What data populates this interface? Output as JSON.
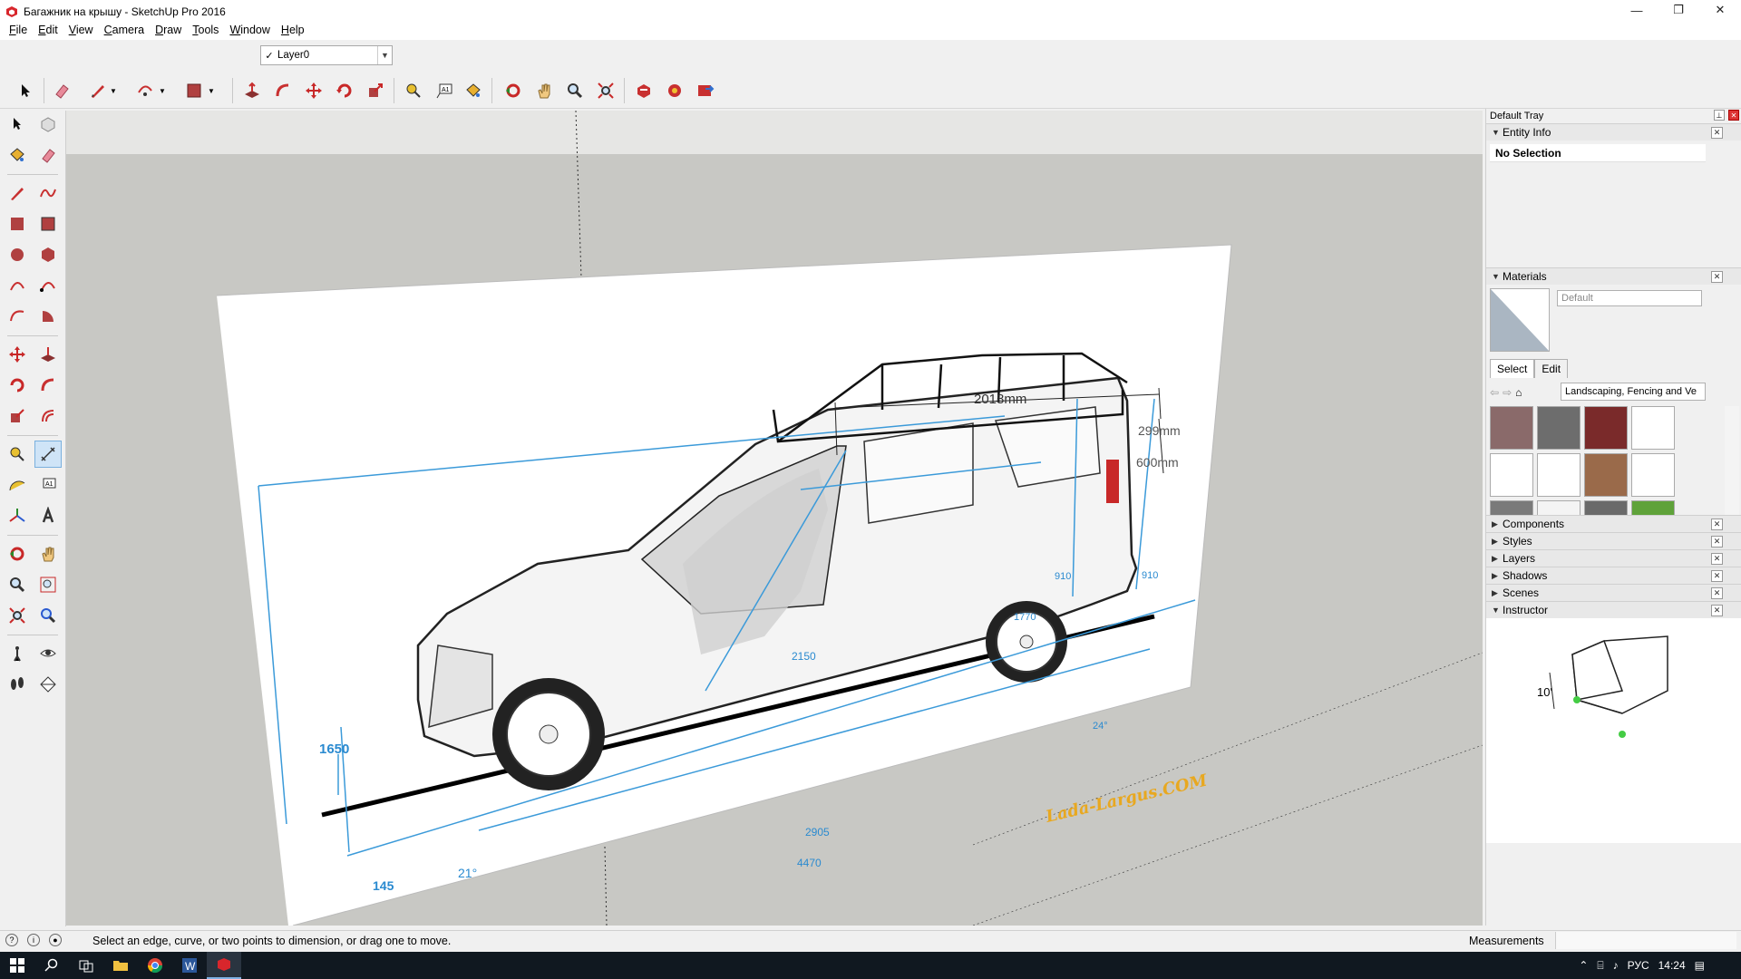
{
  "app": {
    "title": "Багажник на крышу - SketchUp Pro 2016",
    "window_controls": {
      "minimize": "—",
      "restore": "❐",
      "close": "✕"
    }
  },
  "menu": [
    {
      "label": "File",
      "ul": "F",
      "rest": "ile"
    },
    {
      "label": "Edit",
      "ul": "E",
      "rest": "dit"
    },
    {
      "label": "View",
      "ul": "V",
      "rest": "iew"
    },
    {
      "label": "Camera",
      "ul": "C",
      "rest": "amera"
    },
    {
      "label": "Draw",
      "ul": "D",
      "rest": "raw"
    },
    {
      "label": "Tools",
      "ul": "T",
      "rest": "ools"
    },
    {
      "label": "Window",
      "ul": "W",
      "rest": "indow"
    },
    {
      "label": "Help",
      "ul": "H",
      "rest": "elp"
    }
  ],
  "layer_toolbar": {
    "current_layer": "Layer0",
    "check": "✓"
  },
  "viewport": {
    "drawing": {
      "dim_roof_width": "2018mm",
      "dim_roof_height": "299mm",
      "dim_roof_600": "600mm",
      "dim_height": "1650",
      "dim_910_a": "910",
      "dim_910_b": "910",
      "dim_1770": "1770",
      "dim_2150": "2150",
      "dim_2905": "2905",
      "dim_4470": "4470",
      "dim_145": "145",
      "angle_21": "21°",
      "angle_24": "24°",
      "watermark": "Lada-Largus.COM"
    }
  },
  "tray": {
    "title": "Default Tray",
    "entity_info": {
      "title": "Entity Info",
      "selection": "No Selection"
    },
    "materials": {
      "title": "Materials",
      "name_placeholder": "Default",
      "tabs": [
        "Select",
        "Edit"
      ],
      "collection": "Landscaping, Fencing and Ve",
      "swatches": [
        "#8a6a6a",
        "#6d6d6d",
        "#7a2a2a",
        "#ffffff",
        "#ffffff",
        "#ffffff",
        "#9a6a4a",
        "#ffffff",
        "#7a7a7a",
        "#f4f4f4",
        "#6a6a6a",
        "#5fa23a",
        "#8aa83c",
        "#8b8b8b",
        "#a64a3c",
        "#a8896a"
      ]
    },
    "collapsed_panels": [
      "Components",
      "Styles",
      "Layers",
      "Shadows",
      "Scenes"
    ],
    "instructor": {
      "title": "Instructor",
      "dim_label": "10'"
    }
  },
  "status": {
    "message": "Select an edge, curve, or two points to dimension, or drag one to move.",
    "measurements_label": "Measurements"
  },
  "taskbar": {
    "language": "РУС",
    "time": "14:24"
  },
  "colors": {
    "accent_blue": "#3b9ad9",
    "dim_text": "#2a8ad0"
  }
}
